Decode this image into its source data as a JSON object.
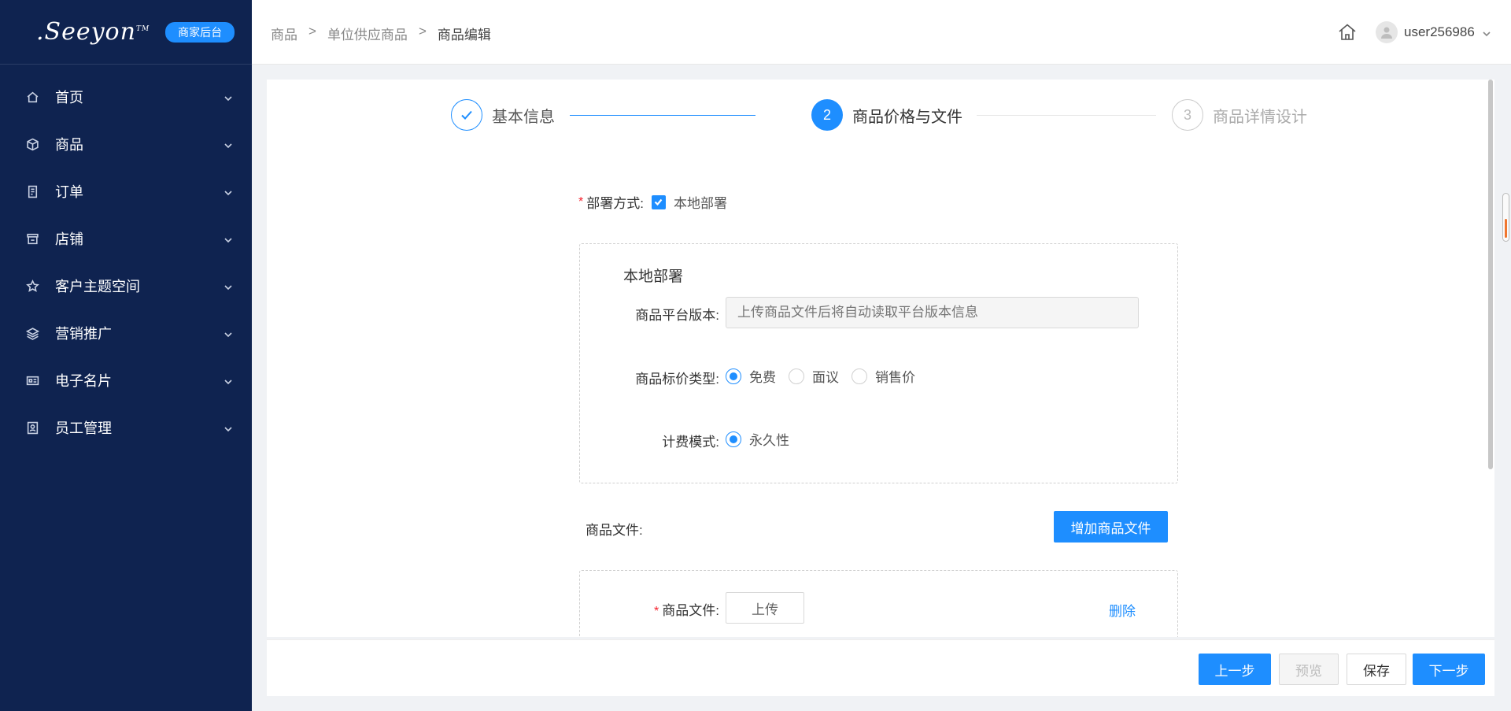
{
  "brand": {
    "logo": ".Seeyon",
    "tm": "TM",
    "badge": "商家后台"
  },
  "sidebar": {
    "items": [
      {
        "label": "首页",
        "icon": "home-icon"
      },
      {
        "label": "商品",
        "icon": "cube-icon"
      },
      {
        "label": "订单",
        "icon": "order-icon"
      },
      {
        "label": "店铺",
        "icon": "store-icon"
      },
      {
        "label": "客户主题空间",
        "icon": "star-icon"
      },
      {
        "label": "营销推广",
        "icon": "layers-icon"
      },
      {
        "label": "电子名片",
        "icon": "id-card-icon"
      },
      {
        "label": "员工管理",
        "icon": "staff-icon"
      }
    ]
  },
  "header": {
    "breadcrumb": [
      "商品",
      "单位供应商品",
      "商品编辑"
    ],
    "breadcrumb_sep": ">",
    "username": "user256986"
  },
  "steps": [
    {
      "number": "1",
      "title": "基本信息",
      "status": "done"
    },
    {
      "number": "2",
      "title": "商品价格与文件",
      "status": "active"
    },
    {
      "number": "3",
      "title": "商品详情设计",
      "status": "pending"
    }
  ],
  "form": {
    "required_mark": "*",
    "deploy_label": "部署方式:",
    "deploy_option": "本地部署",
    "deploy_checked": true,
    "local_section_title": "本地部署",
    "platform_version_label": "商品平台版本:",
    "platform_version_placeholder": "上传商品文件后将自动读取平台版本信息",
    "price_type_label": "商品标价类型:",
    "price_options": [
      "免费",
      "面议",
      "销售价"
    ],
    "price_selected": "免费",
    "billing_label": "计费模式:",
    "billing_option": "永久性",
    "files_label": "商品文件:",
    "add_file_button": "增加商品文件",
    "file_item_label": "商品文件:",
    "upload_button": "上传",
    "delete_link": "删除"
  },
  "footer": {
    "prev": "上一步",
    "preview": "预览",
    "save": "保存",
    "next": "下一步"
  },
  "colors": {
    "sidebar_bg": "#0f2350",
    "primary": "#1e8eff",
    "required": "#f5222d"
  }
}
